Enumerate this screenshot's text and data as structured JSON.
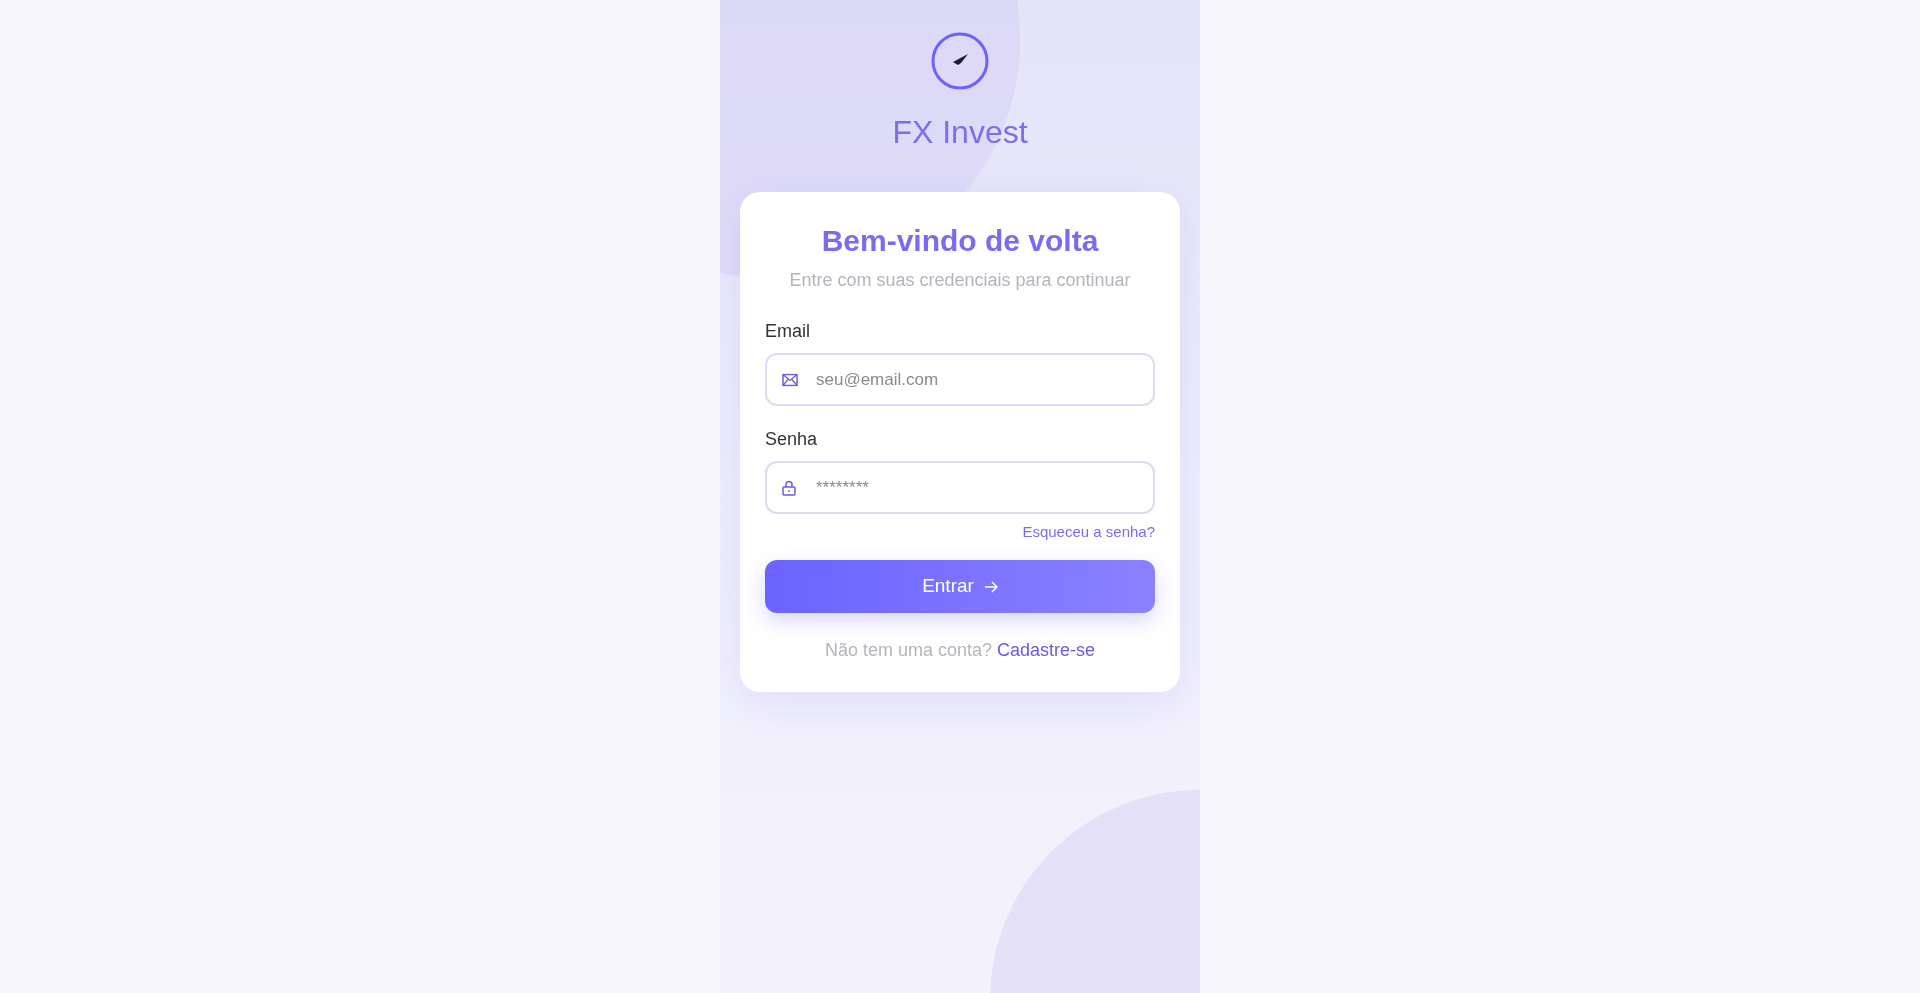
{
  "app": {
    "name": "FX Invest"
  },
  "card": {
    "title": "Bem-vindo de volta",
    "subtitle": "Entre com suas credenciais para continuar"
  },
  "fields": [
    {
      "kind": "email",
      "label": "Email",
      "placeholder": "seu@email.com"
    },
    {
      "kind": "password",
      "label": "Senha",
      "placeholder": "********"
    }
  ],
  "forgot_link": "Esqueceu a senha?",
  "submit_button": "Entrar",
  "signup": {
    "prompt": "Não tem uma conta?",
    "link": "Cadastre-se"
  }
}
